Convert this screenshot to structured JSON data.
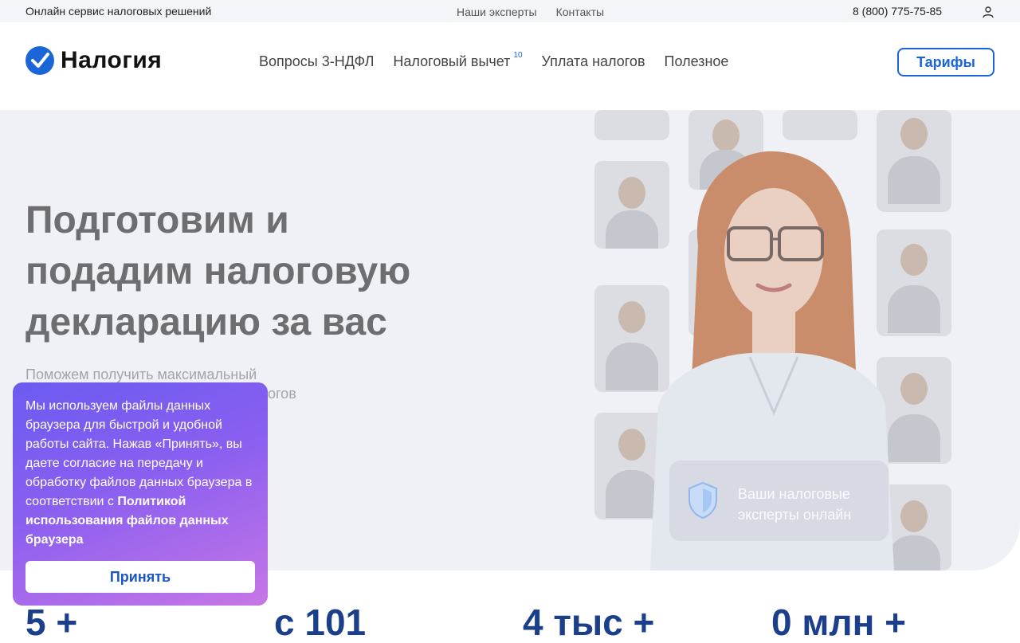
{
  "topbar": {
    "tagline": "Онлайн сервис налоговых решений",
    "links": [
      "Наши эксперты",
      "Контакты"
    ],
    "phone": "8 (800) 775-75-85"
  },
  "header": {
    "logo_text": "Налогия",
    "nav": [
      {
        "label": "Вопросы 3-НДФЛ"
      },
      {
        "label": "Налоговый вычет",
        "badge": "10"
      },
      {
        "label": "Уплата налогов"
      },
      {
        "label": "Полезное"
      }
    ],
    "tariffs_label": "Тарифы"
  },
  "hero": {
    "title_lines": [
      "Подготовим и",
      "подадим налоговую",
      "декларацию за вас"
    ],
    "subtitle_lines": [
      "Поможем получить максимальный",
      "огов"
    ],
    "expert_card": {
      "line1": "Ваши налоговые",
      "line2": "эксперты онлайн"
    }
  },
  "stats": [
    "5 +",
    "с 101",
    "4 тыс +",
    "0 млн +"
  ],
  "cookie": {
    "text_plain": "Мы используем файлы данных браузера для быстрой и удобной работы сайта. Нажав «Принять», вы даете согласие на передачу и обработку файлов данных браузера в соответствии с ",
    "text_link": "Политикой использования файлов данных браузера",
    "accept_label": "Принять"
  },
  "colors": {
    "accent": "#1a66d8",
    "stat": "#1b3f8a",
    "hero_bg": "#f0f1f6"
  }
}
